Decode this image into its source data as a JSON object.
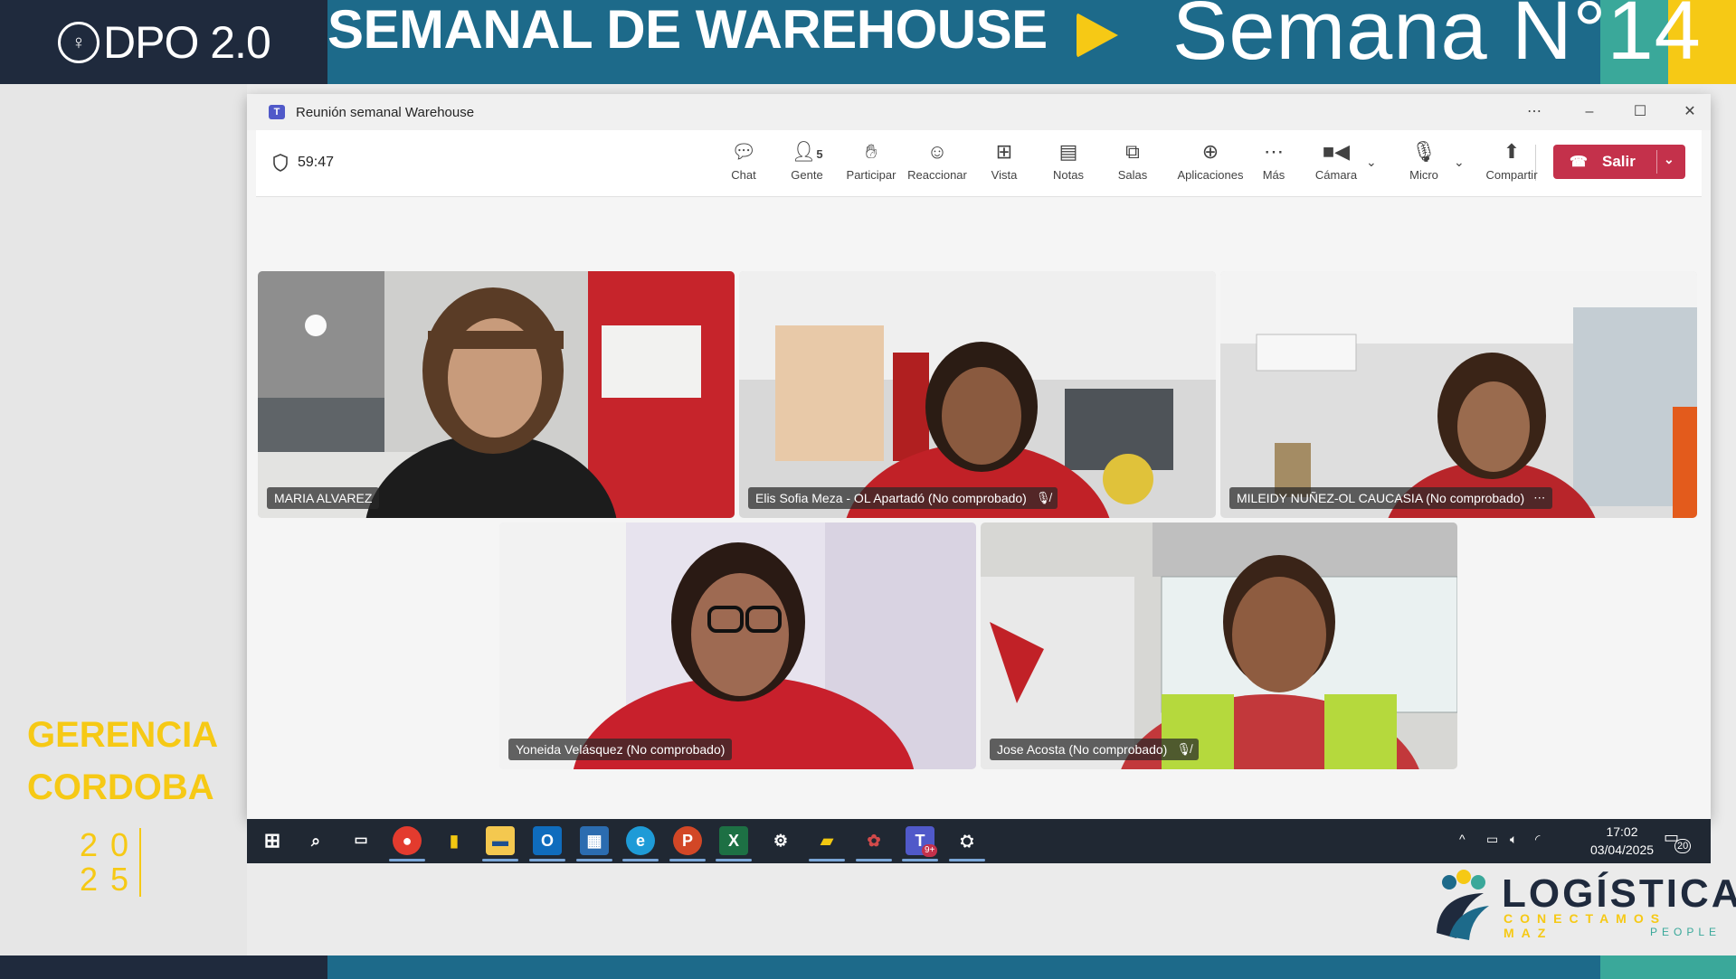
{
  "slide": {
    "logo_text": "DPO 2.0",
    "title": "SEMANAL DE WAREHOUSE",
    "week": "Semana N°14",
    "region_line1": "GERENCIA",
    "region_line2": "CORDOBA",
    "year_top": "20",
    "year_bottom": "25",
    "brand_name": "LOGÍSTICA",
    "brand_tagline": "CONECTAMOS MAZ",
    "brand_people": "PEOPLE",
    "colors": {
      "navy": "#1f2a3d",
      "blue": "#1d6a8a",
      "teal": "#3aa89a",
      "yellow": "#f6c915",
      "leave_red": "#c4314b"
    }
  },
  "window": {
    "title": "Reunión semanal Warehouse",
    "controls": [
      "more-icon",
      "minimize-icon",
      "maximize-icon",
      "close-icon"
    ]
  },
  "toolbar": {
    "timer": "59:47",
    "people_count": "5",
    "items": [
      {
        "label": "Chat",
        "icon": "chat-icon"
      },
      {
        "label": "Gente",
        "icon": "people-icon"
      },
      {
        "label": "Participar",
        "icon": "raise-hand-icon"
      },
      {
        "label": "Reaccionar",
        "icon": "emoji-icon"
      },
      {
        "label": "Vista",
        "icon": "grid-view-icon"
      },
      {
        "label": "Notas",
        "icon": "notes-icon"
      },
      {
        "label": "Salas",
        "icon": "rooms-icon"
      },
      {
        "label": "Aplicaciones",
        "icon": "apps-icon"
      },
      {
        "label": "Más",
        "icon": "more-icon"
      },
      {
        "label": "Cámara",
        "icon": "camera-icon"
      },
      {
        "label": "Micro",
        "icon": "mic-icon"
      },
      {
        "label": "Compartir",
        "icon": "share-icon"
      }
    ],
    "leave_label": "Salir"
  },
  "participants": [
    {
      "name": "MARIA ALVAREZ",
      "muted": false,
      "more": false
    },
    {
      "name": "Elis Sofia Meza - OL Apartadó (No comprobado)",
      "muted": true,
      "more": false
    },
    {
      "name": "MILEIDY NUÑEZ-OL CAUCASIA (No comprobado)",
      "muted": false,
      "more": true
    },
    {
      "name": "Yoneida Velásquez (No comprobado)",
      "muted": false,
      "more": false
    },
    {
      "name": "Jose Acosta (No comprobado)",
      "muted": true,
      "more": false
    }
  ],
  "taskbar": {
    "apps": [
      "windows-start-icon",
      "search-icon",
      "task-view-icon",
      "chrome-icon",
      "power-bi-icon",
      "file-explorer-icon",
      "outlook-icon",
      "app-icon",
      "edge-icon",
      "powerpoint-icon",
      "excel-icon",
      "settings-icon",
      "app-icon",
      "app-icon",
      "teams-icon",
      "app-icon"
    ],
    "teams_badge": "9+",
    "time": "17:02",
    "date": "03/04/2025",
    "notifications": "20"
  }
}
